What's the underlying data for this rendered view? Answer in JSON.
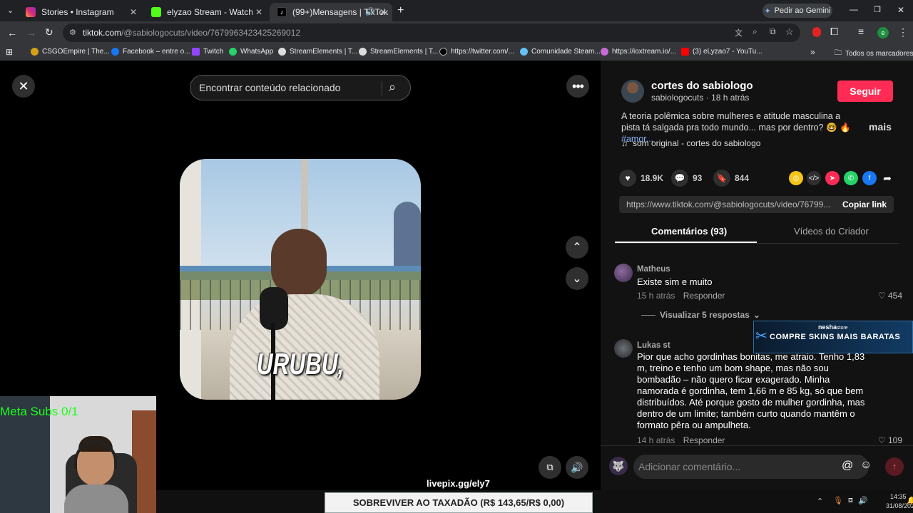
{
  "tabs": [
    {
      "title": "Stories • Instagram",
      "active": false
    },
    {
      "title": "elyzao Stream - Watch Live on Kick",
      "active": false
    },
    {
      "title": "(99+)Mensagens | TikTok",
      "active": true
    }
  ],
  "gemini_button": "Pedir ao Gemini",
  "address": {
    "host": "tiktok.com",
    "path": "/@sabiologocuts/video/7679963423425269012"
  },
  "bookmarks": [
    "CSGOEmpire | The...",
    "Facebook – entre o...",
    "Twitch",
    "WhatsApp",
    "StreamElements | T...",
    "StreamElements | T...",
    "https://twitter.com/...",
    "Comunidade Steam...",
    "https://ioxtream.io/...",
    "(3) eLyzao7 - YouTu..."
  ],
  "all_bookmarks": "Todos os marcadores",
  "search": {
    "placeholder": "Encontrar conteúdo relacionado"
  },
  "video": {
    "subtitle": "URUBU,"
  },
  "overlay": {
    "meta_subs": "Meta Subs 0/1",
    "livepix": "livepix.gg/ely7",
    "ticker": "SOBREVIVER AO TAXADÃO (R$ 143,65/R$ 0,00)"
  },
  "ad": {
    "brand": "nesha",
    "brand_suffix": "store",
    "text": "COMPRE SKINS MAIS BARATAS"
  },
  "author": {
    "name": "cortes do sabiologo",
    "handle": "sabiologocuts",
    "time": "18 h atrás",
    "follow": "Seguir"
  },
  "description": {
    "text": "A teoria polêmica sobre mulheres e atitude masculina a pista tá salgada pra todo mundo... mas por dentro? 🤓 🔥 ",
    "tag": "#amor...",
    "more": "mais"
  },
  "sound": "som original - cortes do sabiologo",
  "stats": {
    "likes": "18.9K",
    "comments": "93",
    "saves": "844"
  },
  "link": {
    "url": "https://www.tiktok.com/@sabiologocuts/video/76799...",
    "copy": "Copiar link"
  },
  "panel_tabs": {
    "comments": "Comentários (93)",
    "creator": "Vídeos do Criador"
  },
  "comments": [
    {
      "user": "Matheus",
      "text": "Existe sim e muito",
      "time": "15 h atrás",
      "reply": "Responder",
      "likes": "454",
      "view_replies": "Visualizar 5 respostas"
    },
    {
      "user": "Lukas st",
      "text": "Pior que acho gordinhas bonitas, me atraio. Tenho 1,83 m, treino e tenho um bom shape, mas não sou bombadão – não quero ficar exagerado. Minha namorada é gordinha, tem 1,66 m e 85 kg, só que bem distribuídos. Até porque gosto de mulher gordinha, mas dentro de um limite; também curto quando mantêm o formato pêra ou ampulheta.",
      "time": "14 h atrás",
      "reply": "Responder",
      "likes": "109"
    }
  ],
  "comment_input": {
    "placeholder": "Adicionar comentário..."
  },
  "clock": {
    "time": "14:35",
    "date": "31/08/2026"
  }
}
